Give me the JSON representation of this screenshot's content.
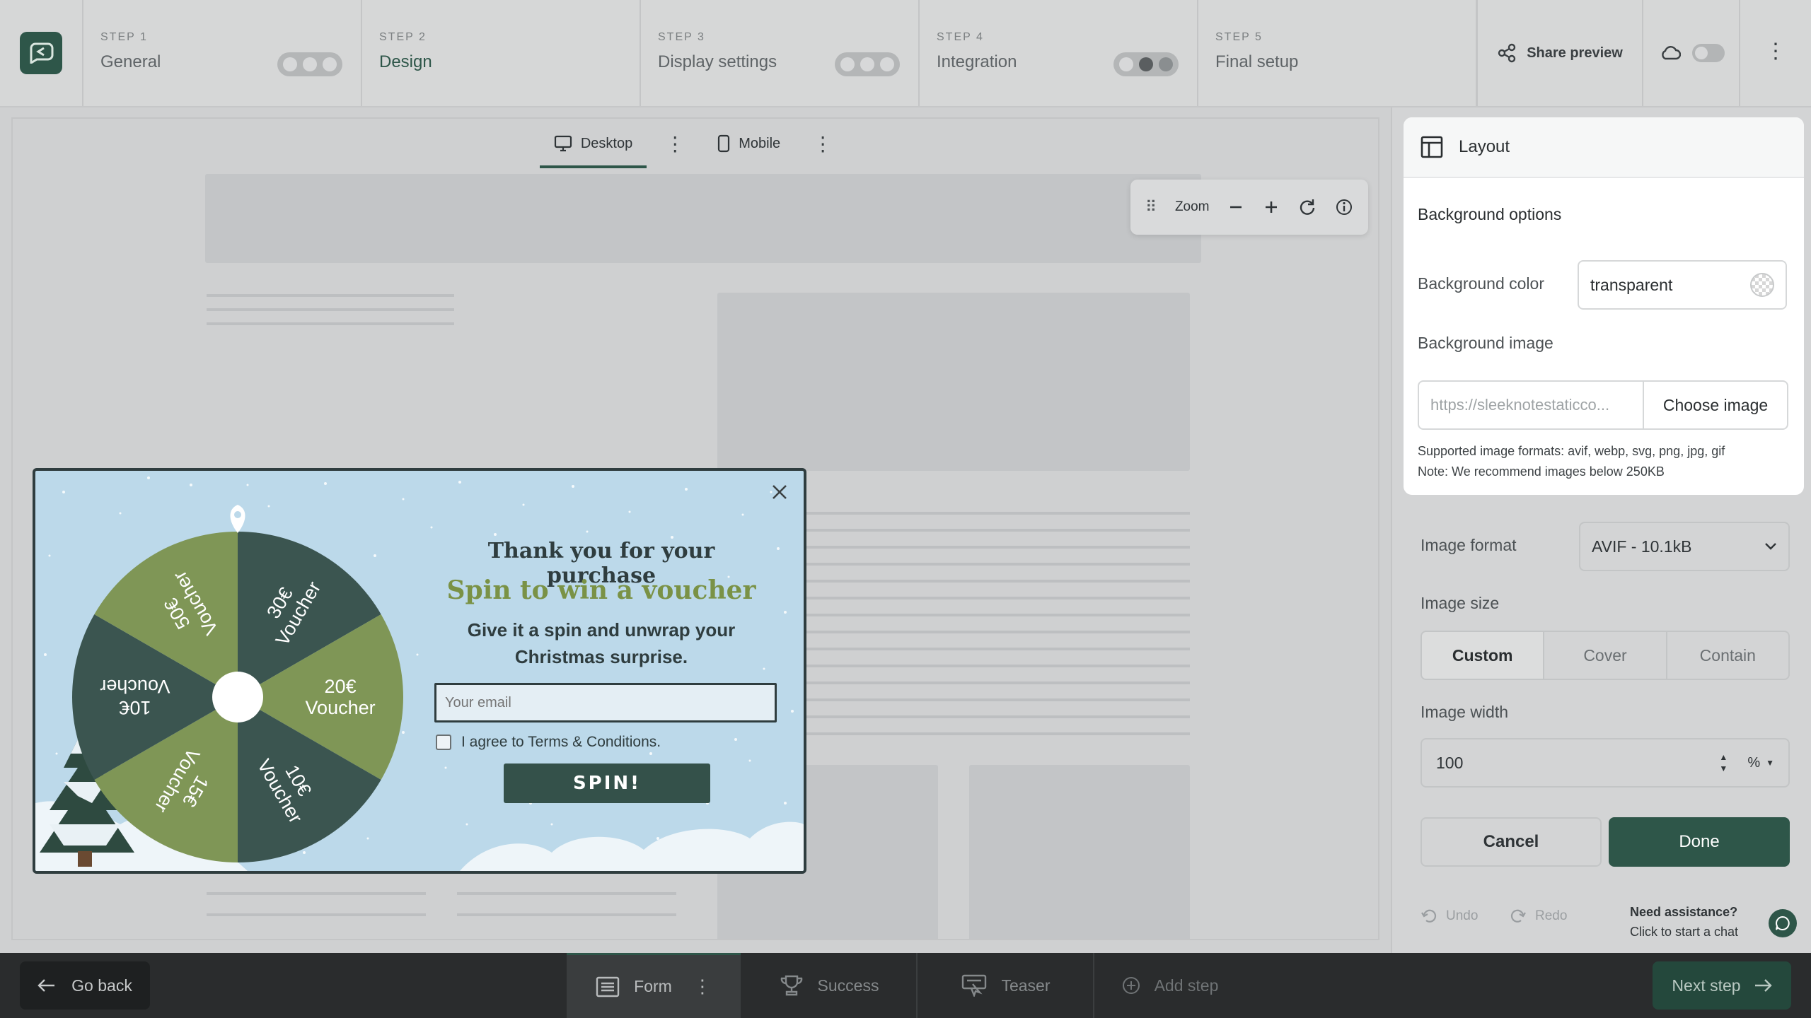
{
  "steps": [
    {
      "num": "STEP 1",
      "name": "General"
    },
    {
      "num": "STEP 2",
      "name": "Design"
    },
    {
      "num": "STEP 3",
      "name": "Display settings"
    },
    {
      "num": "STEP 4",
      "name": "Integration"
    },
    {
      "num": "STEP 5",
      "name": "Final setup"
    }
  ],
  "header": {
    "share_label": "Share preview"
  },
  "canvas": {
    "tabs": [
      {
        "label": "Desktop",
        "icon": "monitor-icon"
      },
      {
        "label": "Mobile",
        "icon": "phone-icon"
      }
    ],
    "zoom_label": "Zoom"
  },
  "popup": {
    "title": "Thank you for your purchase",
    "headline": "Spin to win a voucher",
    "text": "Give it a spin and unwrap your Christmas surprise.",
    "email_placeholder": "Your email",
    "agree": "I agree to Terms & Conditions.",
    "button": "SPIN!",
    "wheel_segments": [
      "30€ Voucher",
      "20€ Voucher",
      "10€ Voucher",
      "15€ Voucher",
      "10€ Voucher",
      "50€ Voucher"
    ],
    "colors": {
      "dark": "#3b5550",
      "green": "#7f9656",
      "button": "#34514a"
    }
  },
  "panel": {
    "title": "Layout",
    "section": "Background options",
    "bg_color_label": "Background color",
    "bg_color_value": "transparent",
    "bg_image_label": "Background image",
    "bg_image_url": "https://sleeknotestaticco...",
    "choose_image": "Choose image",
    "note_formats": "Supported image formats: avif, webp, svg, png, jpg, gif",
    "note_size": "Note: We recommend images below 250KB",
    "image_format_label": "Image format",
    "image_format_value": "AVIF - 10.1kB",
    "image_size_label": "Image size",
    "image_size_options": [
      "Custom",
      "Cover",
      "Contain"
    ],
    "image_size_selected": "Custom",
    "image_width_label": "Image width",
    "image_width_value": "100",
    "image_width_unit": "%",
    "cancel": "Cancel",
    "done": "Done",
    "undo": "Undo",
    "redo": "Redo",
    "assist_title": "Need assistance?",
    "assist_sub": "Click to start a chat"
  },
  "footer": {
    "go_back": "Go back",
    "tabs": [
      "Form",
      "Success",
      "Teaser"
    ],
    "add_step": "Add step",
    "next": "Next step"
  },
  "colors": {
    "brand": "#2e5649"
  }
}
